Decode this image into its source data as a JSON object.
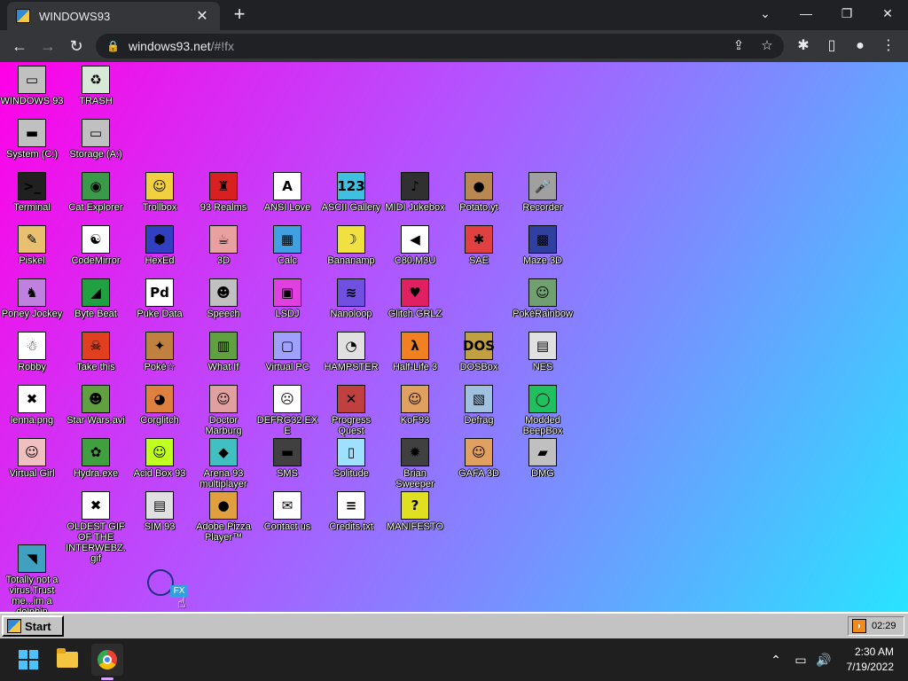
{
  "browser": {
    "tab_title": "WINDOWS93",
    "tab_close": "✕",
    "new_tab": "+",
    "window_controls": [
      "⌄",
      "—",
      "❐",
      "✕"
    ],
    "url_host": "windows93.net",
    "url_path": "/#!fx"
  },
  "desktop": {
    "icons": [
      {
        "label": "WINDOWS 93",
        "glyph": "▭",
        "color": "#c0c0c0"
      },
      {
        "label": "TRASH",
        "glyph": "♻",
        "color": "#d8e8d8"
      },
      {
        "label": "System (C:)",
        "glyph": "▬",
        "color": "#c0c0c0"
      },
      {
        "label": "Storage (A:)",
        "glyph": "▭",
        "color": "#c0c0c0"
      },
      {
        "label": "Terminal",
        "glyph": ">_",
        "color": "#202020"
      },
      {
        "label": "Cat Explorer",
        "glyph": "◉",
        "color": "#3a9a4a"
      },
      {
        "label": "Trollbox",
        "glyph": "☺",
        "color": "#f0d040"
      },
      {
        "label": "93 Realms",
        "glyph": "♜",
        "color": "#d82020"
      },
      {
        "label": "ANSI Love",
        "glyph": "A",
        "color": "#ffffff"
      },
      {
        "label": "ASCII Gallery",
        "glyph": "123",
        "color": "#40c0e0"
      },
      {
        "label": "MIDI Jukebox",
        "glyph": "♪",
        "color": "#303030"
      },
      {
        "label": "Potato.yt",
        "glyph": "●",
        "color": "#b88850"
      },
      {
        "label": "Recorder",
        "glyph": "🎤",
        "color": "#a0a0a0"
      },
      {
        "label": "Piskel",
        "glyph": "✎",
        "color": "#e8c070"
      },
      {
        "label": "CodeMirror",
        "glyph": "☯",
        "color": "#ffffff"
      },
      {
        "label": "HexEd",
        "glyph": "⬢",
        "color": "#3040c0"
      },
      {
        "label": "3D",
        "glyph": "☕",
        "color": "#e8a0a0"
      },
      {
        "label": "Calc",
        "glyph": "▦",
        "color": "#40a0e0"
      },
      {
        "label": "Bananamp",
        "glyph": "☽",
        "color": "#f0e040"
      },
      {
        "label": "C80.M3U",
        "glyph": "◀",
        "color": "#ffffff"
      },
      {
        "label": "SAE",
        "glyph": "✱",
        "color": "#e04040"
      },
      {
        "label": "Maze 3D",
        "glyph": "▩",
        "color": "#3040a0"
      },
      {
        "label": "Poney Jockey",
        "glyph": "♞",
        "color": "#c080e0"
      },
      {
        "label": "Byte Beat",
        "glyph": "◢",
        "color": "#20a040"
      },
      {
        "label": "Puke Data",
        "glyph": "Pd",
        "color": "#ffffff"
      },
      {
        "label": "Speech",
        "glyph": "☻",
        "color": "#c0c0c0"
      },
      {
        "label": "LSDJ",
        "glyph": "▣",
        "color": "#e040e0"
      },
      {
        "label": "Nanoloop",
        "glyph": "≋",
        "color": "#7050e0"
      },
      {
        "label": "Glitch GRLZ",
        "glyph": "♥",
        "color": "#e02060"
      },
      {
        "label": "PokéRainbow",
        "glyph": "☺",
        "color": "#70a070"
      },
      {
        "label": "Robby",
        "glyph": "☃",
        "color": "#ffffff"
      },
      {
        "label": "Take this",
        "glyph": "☠",
        "color": "#e04020"
      },
      {
        "label": "Poké☆",
        "glyph": "✦",
        "color": "#c08040"
      },
      {
        "label": "What If",
        "glyph": "▥",
        "color": "#60a040"
      },
      {
        "label": "Virtual PC",
        "glyph": "▢",
        "color": "#a0a0ff"
      },
      {
        "label": "HAMPSTER",
        "glyph": "◔",
        "color": "#e0e0e0"
      },
      {
        "label": "Half-Life 3",
        "glyph": "λ",
        "color": "#f08020"
      },
      {
        "label": "DOSBox",
        "glyph": "DOS",
        "color": "#c0a040"
      },
      {
        "label": "NES",
        "glyph": "▤",
        "color": "#e0e0e0"
      },
      {
        "label": "lenna.png",
        "glyph": "✖",
        "color": "#ffffff"
      },
      {
        "label": "Star Wars.avi",
        "glyph": "☻",
        "color": "#60a040"
      },
      {
        "label": "Corglitch",
        "glyph": "◕",
        "color": "#e08040"
      },
      {
        "label": "Doctor Marburg",
        "glyph": "☺",
        "color": "#e0a0a0"
      },
      {
        "label": "DEFRG32.EXE",
        "glyph": "☹",
        "color": "#ffffff"
      },
      {
        "label": "Progress Quest",
        "glyph": "✕",
        "color": "#c04040"
      },
      {
        "label": "KoF93",
        "glyph": "☺",
        "color": "#e0a060"
      },
      {
        "label": "Defrag",
        "glyph": "▧",
        "color": "#a0c0e0"
      },
      {
        "label": "Modded BeepBox",
        "glyph": "◯",
        "color": "#20c060"
      },
      {
        "label": "Virtual Girl",
        "glyph": "☺",
        "color": "#f0c0c0"
      },
      {
        "label": "Hydra.exe",
        "glyph": "✿",
        "color": "#40a040"
      },
      {
        "label": "Acid Box 93",
        "glyph": "☺",
        "color": "#c0ff20"
      },
      {
        "label": "Arena 93 multiplayer",
        "glyph": "◆",
        "color": "#40c0c0"
      },
      {
        "label": "SMS",
        "glyph": "▬",
        "color": "#404040"
      },
      {
        "label": "Solitude",
        "glyph": "▯",
        "color": "#a0e0ff"
      },
      {
        "label": "Brian Sweeper",
        "glyph": "✹",
        "color": "#404040"
      },
      {
        "label": "GAFA 3D",
        "glyph": "☺",
        "color": "#e0a060"
      },
      {
        "label": "DMG",
        "glyph": "▰",
        "color": "#c0c0c0"
      },
      {
        "label": "OLDEST GIF OF THE INTERWEBZ.gif",
        "glyph": "✖",
        "color": "#ffffff"
      },
      {
        "label": "SIM 93",
        "glyph": "▤",
        "color": "#e0e0e0"
      },
      {
        "label": "Adobe Pizza Player™",
        "glyph": "●",
        "color": "#e0a040"
      },
      {
        "label": "Contact us",
        "glyph": "✉",
        "color": "#ffffff"
      },
      {
        "label": "Credits.txt",
        "glyph": "≡",
        "color": "#ffffff"
      },
      {
        "label": "MANIFESTO",
        "glyph": "?",
        "color": "#e0e020"
      },
      {
        "label": "Totally not a virus.Trust me...im a dolphin",
        "glyph": "◥",
        "color": "#40a0c0"
      }
    ]
  },
  "win93_taskbar": {
    "start_label": "Start",
    "rss_glyph": "◗",
    "clock": "02:29"
  },
  "win11_taskbar": {
    "time": "2:30 AM",
    "date": "7/19/2022",
    "tray_icons": [
      "⌃",
      "▭",
      "🔊"
    ]
  }
}
